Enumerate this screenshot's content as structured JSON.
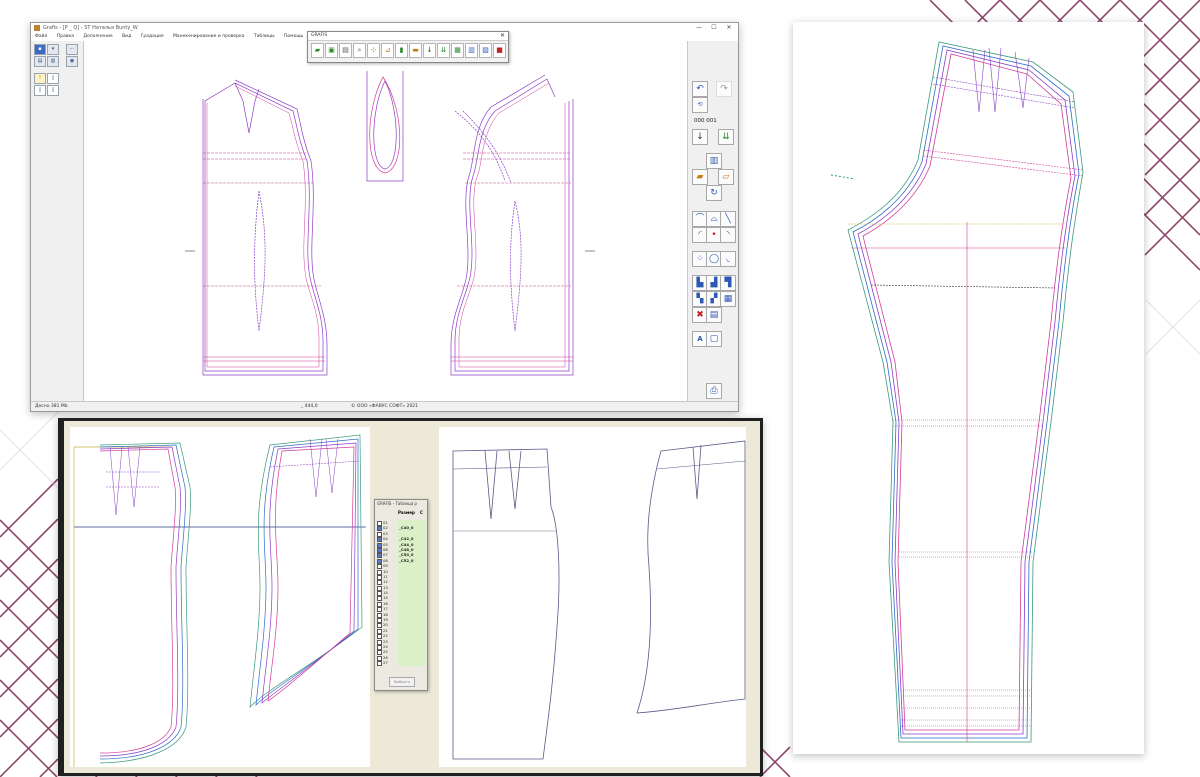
{
  "background": {
    "line_color": "#7a2a52"
  },
  "app_window": {
    "title": "Grafis - [P _ Q] - ST Наталья Bunty_W",
    "controls": {
      "minimize": "—",
      "maximize": "☐",
      "close": "✕"
    },
    "menu": [
      "Файл",
      "Правка",
      "Дополнение",
      "Вид",
      "Градация",
      "Манекенирование и проверка",
      "Таблицы",
      "Помощь"
    ],
    "float_toolbar": {
      "title": "GRAFIS",
      "close": "✕"
    },
    "right_panel": {
      "counter": "000 001"
    },
    "statusbar": {
      "memory": "Десно 381 Mb",
      "coord": "_ 444,0",
      "copyright": "© ООО «ФАВУС СОФТ» 2021"
    },
    "colors": {
      "purple": "#8a3ec8",
      "pink": "#d23c96",
      "accent": "#3a6cc4"
    }
  },
  "size_table": {
    "title": "GRAFIS - Таблица р",
    "header": {
      "size": "Размер",
      "ext": "С"
    },
    "rows": [
      {
        "n": "01",
        "size": "",
        "checked": false
      },
      {
        "n": "02",
        "size": "_C40_0",
        "checked": true
      },
      {
        "n": "03",
        "size": "",
        "checked": false
      },
      {
        "n": "04",
        "size": "_C42_0",
        "checked": true
      },
      {
        "n": "05",
        "size": "_C44_0",
        "checked": true
      },
      {
        "n": "06",
        "size": "_C48_0",
        "checked": true
      },
      {
        "n": "07",
        "size": "_C50_0",
        "checked": true
      },
      {
        "n": "08",
        "size": "_C52_0",
        "checked": true
      },
      {
        "n": "09",
        "size": "",
        "checked": false
      },
      {
        "n": "10",
        "size": "",
        "checked": false
      },
      {
        "n": "11",
        "size": "",
        "checked": false
      },
      {
        "n": "12",
        "size": "",
        "checked": false
      },
      {
        "n": "13",
        "size": "",
        "checked": false
      },
      {
        "n": "14",
        "size": "",
        "checked": false
      },
      {
        "n": "15",
        "size": "",
        "checked": false
      },
      {
        "n": "16",
        "size": "",
        "checked": false
      },
      {
        "n": "17",
        "size": "",
        "checked": false
      },
      {
        "n": "18",
        "size": "",
        "checked": false
      },
      {
        "n": "19",
        "size": "",
        "checked": false
      },
      {
        "n": "20",
        "size": "",
        "checked": false
      },
      {
        "n": "21",
        "size": "",
        "checked": false
      },
      {
        "n": "22",
        "size": "",
        "checked": false
      },
      {
        "n": "23",
        "size": "",
        "checked": false
      },
      {
        "n": "24",
        "size": "",
        "checked": false
      },
      {
        "n": "25",
        "size": "",
        "checked": false
      },
      {
        "n": "26",
        "size": "",
        "checked": false
      },
      {
        "n": "27",
        "size": "",
        "checked": false
      }
    ],
    "button": "Выбрать"
  }
}
